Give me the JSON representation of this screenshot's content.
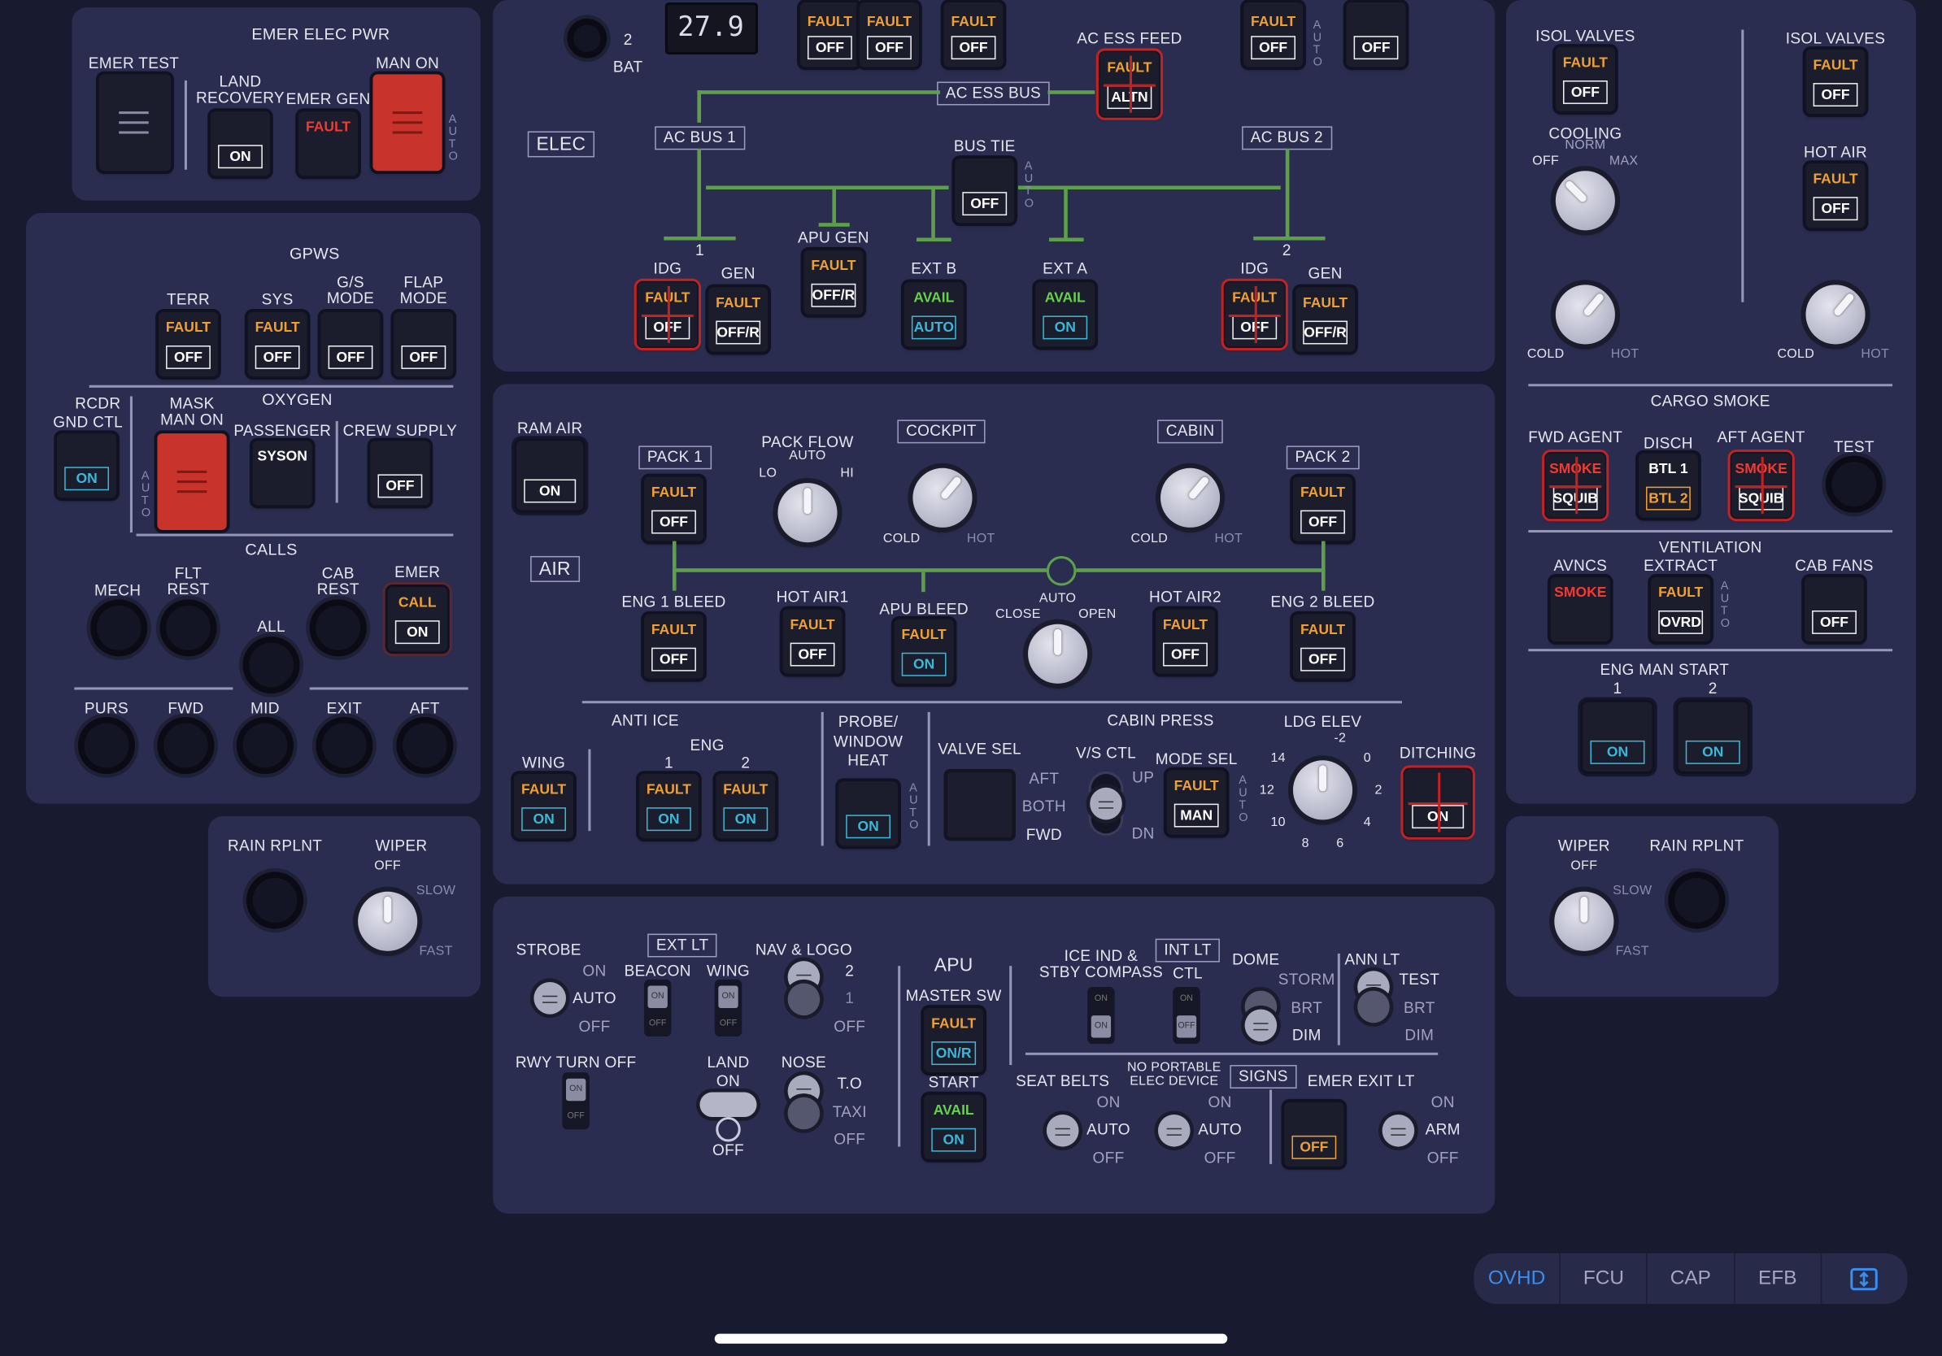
{
  "elec": {
    "emer_title": "EMER ELEC PWR",
    "emer_test": "EMER TEST",
    "land_recovery": "LAND\nRECOVERY",
    "emer_gen": "EMER GEN",
    "man_on": "MAN ON",
    "auto": "A\nU\nT\nO",
    "bat": "BAT",
    "bat_num": "2",
    "bat_volts": "27.9",
    "elec_label": "ELEC",
    "ac_ess_feed": "AC ESS FEED",
    "ac_ess_bus": "AC ESS BUS",
    "ac_bus_1": "AC BUS 1",
    "ac_bus_2": "AC BUS 2",
    "bus_tie": "BUS TIE",
    "apu_gen": "APU GEN",
    "ext_b": "EXT B",
    "ext_a": "EXT A",
    "idg": "IDG",
    "gen": "GEN",
    "one": "1",
    "two": "2"
  },
  "gpws": {
    "title": "GPWS",
    "terr": "TERR",
    "sys": "SYS",
    "gs_mode": "G/S\nMODE",
    "flap_mode": "FLAP\nMODE"
  },
  "oxygen": {
    "title": "OXYGEN",
    "rcdr": "RCDR",
    "gnd_ctl": "GND CTL",
    "mask_man_on": "MASK\nMAN ON",
    "passenger": "PASSENGER",
    "crew_supply": "CREW SUPPLY",
    "syson": "SYSON"
  },
  "calls": {
    "title": "CALLS",
    "mech": "MECH",
    "flt_rest": "FLT\nREST",
    "cab_rest": "CAB\nREST",
    "emer": "EMER",
    "all": "ALL",
    "call": "CALL",
    "purs": "PURS",
    "fwd": "FWD",
    "mid": "MID",
    "exit": "EXIT",
    "aft": "AFT"
  },
  "wiper_l": {
    "rain": "RAIN RPLNT",
    "wiper": "WIPER",
    "off": "OFF",
    "slow": "SLOW",
    "fast": "FAST"
  },
  "wiper_r": {
    "rain": "RAIN RPLNT",
    "wiper": "WIPER",
    "off": "OFF",
    "slow": "SLOW",
    "fast": "FAST"
  },
  "air": {
    "ram_air": "RAM AIR",
    "air_label": "AIR",
    "pack1": "PACK 1",
    "pack2": "PACK 2",
    "pack_flow": "PACK FLOW",
    "auto": "AUTO",
    "lo": "LO",
    "hi": "HI",
    "cockpit": "COCKPIT",
    "cabin": "CABIN",
    "cold": "COLD",
    "hot": "HOT",
    "eng1_bleed": "ENG 1 BLEED",
    "hot_air1": "HOT AIR1",
    "apu_bleed": "APU BLEED",
    "close": "CLOSE",
    "open": "OPEN",
    "hot_air2": "HOT AIR2",
    "eng2_bleed": "ENG 2 BLEED"
  },
  "anti_ice": {
    "title": "ANTI ICE",
    "wing": "WING",
    "eng": "ENG",
    "one": "1",
    "two": "2",
    "probe": "PROBE/\nWINDOW\nHEAT"
  },
  "press": {
    "title": "CABIN PRESS",
    "valve_sel": "VALVE SEL",
    "aft": "AFT",
    "both": "BOTH",
    "fwd": "FWD",
    "vs_ctl": "V/S CTL",
    "up": "UP",
    "dn": "DN",
    "mode_sel": "MODE SEL",
    "man": "MAN",
    "ldg_elev": "LDG ELEV",
    "ditching": "DITCHING",
    "scale": [
      "-2",
      "0",
      "2",
      "4",
      "6",
      "8",
      "10",
      "12",
      "14"
    ]
  },
  "lights": {
    "strobe": "STROBE",
    "on": "ON",
    "auto": "AUTO",
    "off": "OFF",
    "ext_lt": "EXT LT",
    "beacon": "BEACON",
    "wing": "WING",
    "nav_logo": "NAV & LOGO",
    "two": "2",
    "one": "1",
    "rwy_turn_off": "RWY TURN OFF",
    "land": "LAND",
    "nose": "NOSE",
    "to": "T.O",
    "taxi": "TAXI",
    "apu": "APU",
    "master_sw": "MASTER SW",
    "on_r": "ON/R",
    "start": "START",
    "avail": "AVAIL",
    "ice_ind": "ICE IND &\nSTBY COMPASS",
    "int_lt": "INT LT",
    "ctl": "CTL",
    "dome": "DOME",
    "storm": "STORM",
    "brt": "BRT",
    "dim": "DIM",
    "ann_lt": "ANN LT",
    "test": "TEST",
    "seat_belts": "SEAT BELTS",
    "no_portable": "NO PORTABLE\nELEC DEVICE",
    "signs": "SIGNS",
    "emer_exit_lt": "EMER EXIT LT",
    "arm": "ARM"
  },
  "right": {
    "isol_valves": "ISOL VALVES",
    "cooling": "COOLING",
    "norm": "NORM",
    "max": "MAX",
    "off": "OFF",
    "hot_air": "HOT AIR",
    "cold": "COLD",
    "hot": "HOT",
    "cargo_smoke": "CARGO SMOKE",
    "fwd_agent": "FWD AGENT",
    "disch": "DISCH",
    "aft_agent": "AFT AGENT",
    "test": "TEST",
    "smoke": "SMOKE",
    "squib": "SQUIB",
    "btl1": "BTL 1",
    "btl2": "BTL 2",
    "ventilation": "VENTILATION",
    "avncs": "AVNCS",
    "extract": "EXTRACT",
    "cab_fans": "CAB FANS",
    "ovrd": "OVRD",
    "auto": "A\nU\nT\nO",
    "eng_man_start": "ENG MAN START",
    "one": "1",
    "two": "2"
  },
  "pb": {
    "fault": "FAULT",
    "off": "OFF",
    "on": "ON",
    "offr": "OFF/R",
    "avail": "AVAIL",
    "auto": "AUTO",
    "altn": "ALTN"
  },
  "tabs": [
    {
      "label": "OVHD"
    },
    {
      "label": "FCU"
    },
    {
      "label": "CAP"
    },
    {
      "label": "EFB"
    }
  ],
  "colors": {
    "panel": "#2b2d50",
    "background": "#181a30",
    "fault_amber": "#f0a030",
    "fault_red": "#f03a32",
    "avail_green": "#64d24a",
    "on_cyan": "#3ab8d8",
    "bus_line_green": "#5ea04a",
    "tab_active": "#3a8ef0"
  }
}
